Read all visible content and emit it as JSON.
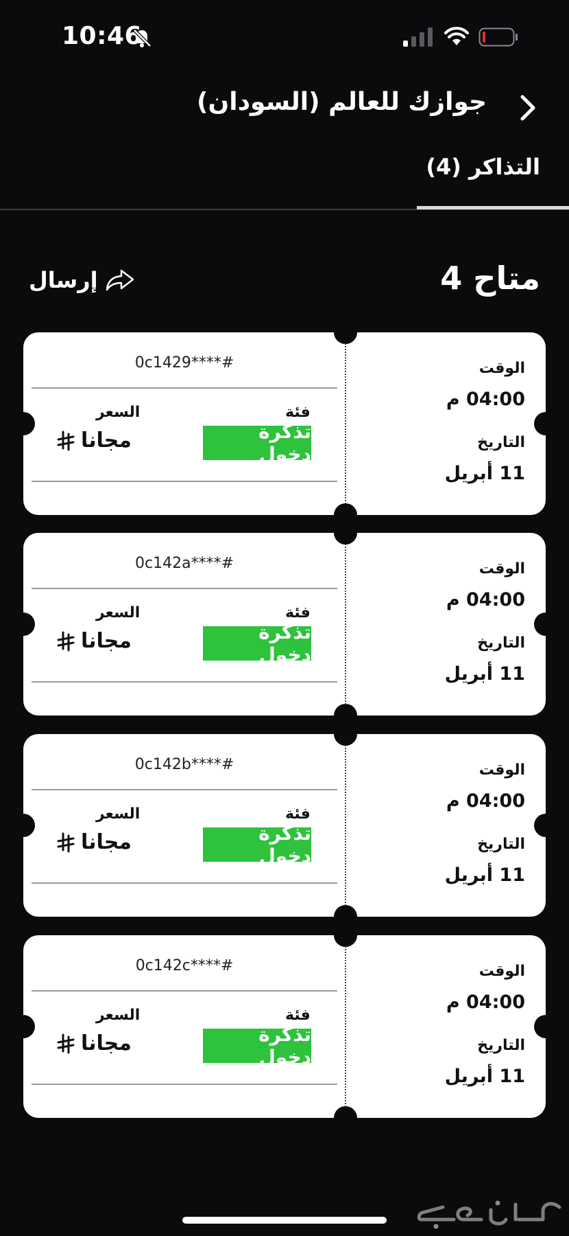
{
  "status_bar": {
    "time": "10:46"
  },
  "header": {
    "title": "جوازك للعالم (السودان)"
  },
  "tabs": [
    {
      "label": "التذاكر (4)"
    }
  ],
  "summary": {
    "available": "متاح 4",
    "send_label": "إرسال"
  },
  "ticket_labels": {
    "time": "الوقت",
    "date": "التاريخ",
    "category": "فئة",
    "price": "السعر"
  },
  "tickets": [
    {
      "code": "#****0c1429",
      "time": "04:00 م",
      "date": "11 أبريل",
      "category": "تذكرة دخول",
      "price": "مجانا"
    },
    {
      "code": "#****0c142a",
      "time": "04:00 م",
      "date": "11 أبريل",
      "category": "تذكرة دخول",
      "price": "مجانا"
    },
    {
      "code": "#****0c142b",
      "time": "04:00 م",
      "date": "11 أبريل",
      "category": "تذكرة دخول",
      "price": "مجانا"
    },
    {
      "code": "#****0c142c",
      "time": "04:00 م",
      "date": "11 أبريل",
      "category": "تذكرة دخول",
      "price": "مجانا"
    }
  ],
  "watermark": "حراج",
  "colors": {
    "background": "#0b0b0d",
    "accent_green": "#2ec23d",
    "battery_low": "#e0302b"
  },
  "icons": [
    "bell-slash-icon",
    "signal-icon",
    "wifi-icon",
    "battery-icon",
    "chevron-right-icon",
    "share-icon",
    "riyal-icon"
  ]
}
